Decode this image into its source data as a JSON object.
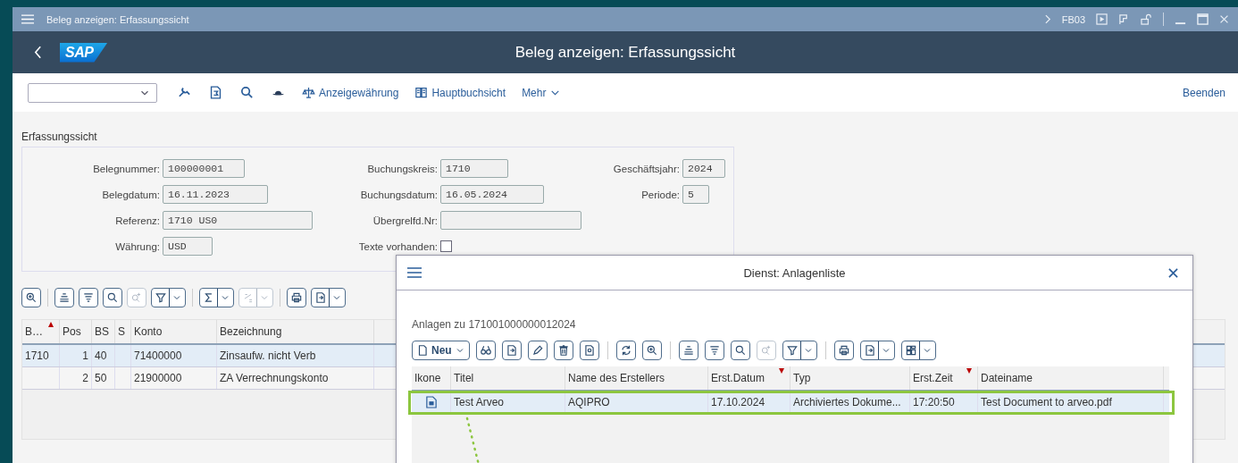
{
  "title_bar": {
    "title": "Beleg anzeigen: Erfassungssicht",
    "transaction": "FB03"
  },
  "header": {
    "logo": "SAP",
    "title": "Beleg anzeigen: Erfassungssicht"
  },
  "toolbar": {
    "actions": [
      {
        "label": "Anzeigewährung",
        "kind": "currency"
      },
      {
        "label": "Hauptbuchsicht",
        "kind": "ledger"
      }
    ],
    "more": "Mehr",
    "exit": "Beenden"
  },
  "form": {
    "title": "Erfassungssicht",
    "rows": [
      [
        {
          "label": "Belegnummer:",
          "value": "100000001",
          "kind": "field"
        },
        {
          "label": "Buchungskreis:",
          "value": "1710",
          "kind": "field"
        },
        {
          "label": "Geschäftsjahr:",
          "value": "2024",
          "kind": "field"
        }
      ],
      [
        {
          "label": "Belegdatum:",
          "value": "16.11.2023",
          "kind": "field"
        },
        {
          "label": "Buchungsdatum:",
          "value": "16.05.2024",
          "kind": "field"
        },
        {
          "label": "Periode:",
          "value": "5",
          "kind": "field"
        }
      ],
      [
        {
          "label": "Referenz:",
          "value": "1710 US0",
          "kind": "field"
        },
        {
          "label": "Übergrelfd.Nr:",
          "kind": "field"
        }
      ],
      [
        {
          "label": "Währung:",
          "value": "USD",
          "kind": "field"
        },
        {
          "label": "Texte vorhanden:",
          "checked": false,
          "kind": "checkbox"
        }
      ]
    ]
  },
  "items_table": {
    "columns": [
      {
        "label": "B…",
        "sorted": true
      },
      {
        "label": "Pos",
        "sorted": false
      },
      {
        "label": "BS",
        "sorted": false
      },
      {
        "label": "S",
        "sorted": false
      },
      {
        "label": "Konto",
        "sorted": false
      },
      {
        "label": "Bezeichnung",
        "sorted": false
      }
    ],
    "rows": [
      {
        "selected": true,
        "cells": [
          "1710",
          "1",
          "40",
          "",
          "71400000",
          "Zinsaufw. nicht Verb"
        ]
      },
      {
        "selected": false,
        "cells": [
          "",
          "2",
          "50",
          "",
          "21900000",
          "ZA Verrechnungskonto"
        ]
      }
    ]
  },
  "dialog": {
    "title": "Dienst: Anlagenliste",
    "caption": "Anlagen zu 171001000000012024",
    "new_button": "Neu",
    "columns": [
      {
        "label": "Ikone",
        "sorted": false
      },
      {
        "label": "Titel",
        "sorted": false
      },
      {
        "label": "Name des Erstellers",
        "sorted": false
      },
      {
        "label": "Erst.Datum",
        "sorted": true
      },
      {
        "label": "Typ",
        "sorted": false
      },
      {
        "label": "Erst.Zeit",
        "sorted": true
      },
      {
        "label": "Dateiname",
        "sorted": false
      }
    ],
    "rows": [
      {
        "selected": true,
        "highlighted": true,
        "title": "Test Arveo",
        "creator": "AQIPRO",
        "date": "17.10.2024",
        "type": "Archiviertes Dokume...",
        "time": "17:20:50",
        "filename": "Test Document to arveo.pdf"
      }
    ]
  }
}
